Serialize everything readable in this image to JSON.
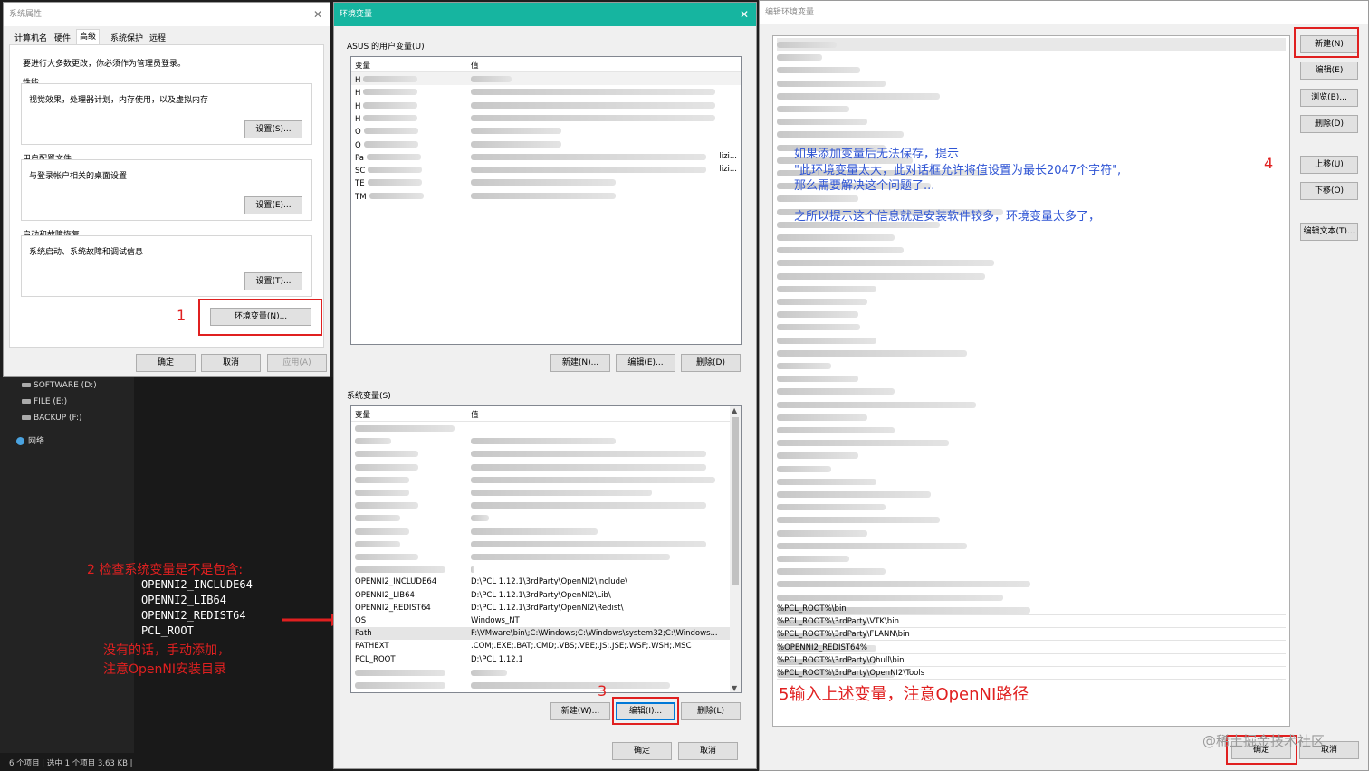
{
  "sys_props": {
    "title": "系统属性",
    "tabs": [
      "计算机名",
      "硬件",
      "高级",
      "系统保护",
      "远程"
    ],
    "admin_note": "要进行大多数更改，你必须作为管理员登录。",
    "perf_title": "性能",
    "perf_desc": "视觉效果，处理器计划，内存使用，以及虚拟内存",
    "perf_btn": "设置(S)...",
    "profile_title": "用户配置文件",
    "profile_desc": "与登录帐户相关的桌面设置",
    "profile_btn": "设置(E)...",
    "startup_title": "启动和故障恢复",
    "startup_desc": "系统启动、系统故障和调试信息",
    "startup_btn": "设置(T)...",
    "env_btn": "环境变量(N)...",
    "ok": "确定",
    "cancel": "取消",
    "apply": "应用(A)"
  },
  "explorer": {
    "drives": [
      "SOFTWARE (D:)",
      "FILE (E:)",
      "BACKUP (F:)"
    ],
    "network": "网络",
    "status": "6 个项目  |  选中 1 个项目  3.63 KB  |"
  },
  "env_vars": {
    "title": "环境变量",
    "user_section": "ASUS 的用户变量(U)",
    "col_var": "变量",
    "col_val": "值",
    "user_rows": [
      {
        "var": "H",
        "val": "",
        "c2_trail": ""
      },
      {
        "var": "H",
        "val": "",
        "c2_trail": ""
      },
      {
        "var": "H",
        "val": "",
        "c2_trail": ""
      },
      {
        "var": "H",
        "val": "",
        "c2_trail": ""
      },
      {
        "var": "O",
        "val": "",
        "c2_trail": ""
      },
      {
        "var": "O",
        "val": "",
        "c2_trail": ""
      },
      {
        "var": "Pa",
        "val": "",
        "c2_trail": "lizi..."
      },
      {
        "var": "SC",
        "val": "",
        "c2_trail": "lizi..."
      },
      {
        "var": "TE",
        "val": "",
        "c2_trail": ""
      },
      {
        "var": "TM",
        "val": "",
        "c2_trail": ""
      }
    ],
    "user_new": "新建(N)...",
    "user_edit": "编辑(E)...",
    "user_delete": "删除(D)",
    "sys_section": "系统变量(S)",
    "sys_rows": [
      {
        "var": "OPENNI2_INCLUDE64",
        "val": "D:\\PCL 1.12.1\\3rdParty\\OpenNI2\\Include\\"
      },
      {
        "var": "OPENNI2_LIB64",
        "val": "D:\\PCL 1.12.1\\3rdParty\\OpenNI2\\Lib\\"
      },
      {
        "var": "OPENNI2_REDIST64",
        "val": "D:\\PCL 1.12.1\\3rdParty\\OpenNI2\\Redist\\"
      },
      {
        "var": "OS",
        "val": "Windows_NT"
      },
      {
        "var": "Path",
        "val": "F:\\VMware\\bin\\;C:\\Windows;C:\\Windows\\system32;C:\\Windows..."
      },
      {
        "var": "PATHEXT",
        "val": ".COM;.EXE;.BAT;.CMD;.VBS;.VBE;.JS;.JSE;.WSF;.WSH;.MSC"
      },
      {
        "var": "PCL_ROOT",
        "val": "D:\\PCL 1.12.1"
      }
    ],
    "sys_new": "新建(W)...",
    "sys_edit": "编辑(I)...",
    "sys_delete": "删除(L)",
    "ok": "确定",
    "cancel": "取消"
  },
  "edit_env": {
    "title": "编辑环境变量",
    "visible_entries": [
      "%PCL_ROOT%\\bin",
      "%PCL_ROOT%\\3rdParty\\VTK\\bin",
      "%PCL_ROOT%\\3rdParty\\FLANN\\bin",
      "%OPENNI2_REDIST64%",
      "%PCL_ROOT%\\3rdParty\\Qhull\\bin",
      "%PCL_ROOT%\\3rdParty\\OpenNI2\\Tools"
    ],
    "buttons": [
      "新建(N)",
      "编辑(E)",
      "浏览(B)...",
      "删除(D)",
      "上移(U)",
      "下移(O)",
      "编辑文本(T)..."
    ],
    "ok": "确定",
    "cancel": "取消"
  },
  "annotations": {
    "n1": "1",
    "n2_title": "2 检查系统变量是不是包含:",
    "n2_vars": [
      "OPENNI2_INCLUDE64",
      "OPENNI2_LIB64",
      "OPENNI2_REDIST64",
      "PCL_ROOT"
    ],
    "n2_note1": "没有的话，手动添加，",
    "n2_note2": "注意OpenNI安装目录",
    "n3": "3",
    "n4": "4",
    "n5": "5输入上述变量，注意OpenNI路径",
    "blue1": "如果添加变量后无法保存，提示",
    "blue2": "\"此环境变量太大，此对话框允许将值设置为最长2047个字符\",",
    "blue3": "那么需要解决这个问题了...",
    "blue4": "之所以提示这个信息就是安装软件较多，环境变量太多了，",
    "watermark": "@稀土掘金技术社区"
  },
  "colors": {
    "accent_red": "#e02020",
    "teal_title": "#16b5a0",
    "note_blue": "#2f55d4"
  }
}
